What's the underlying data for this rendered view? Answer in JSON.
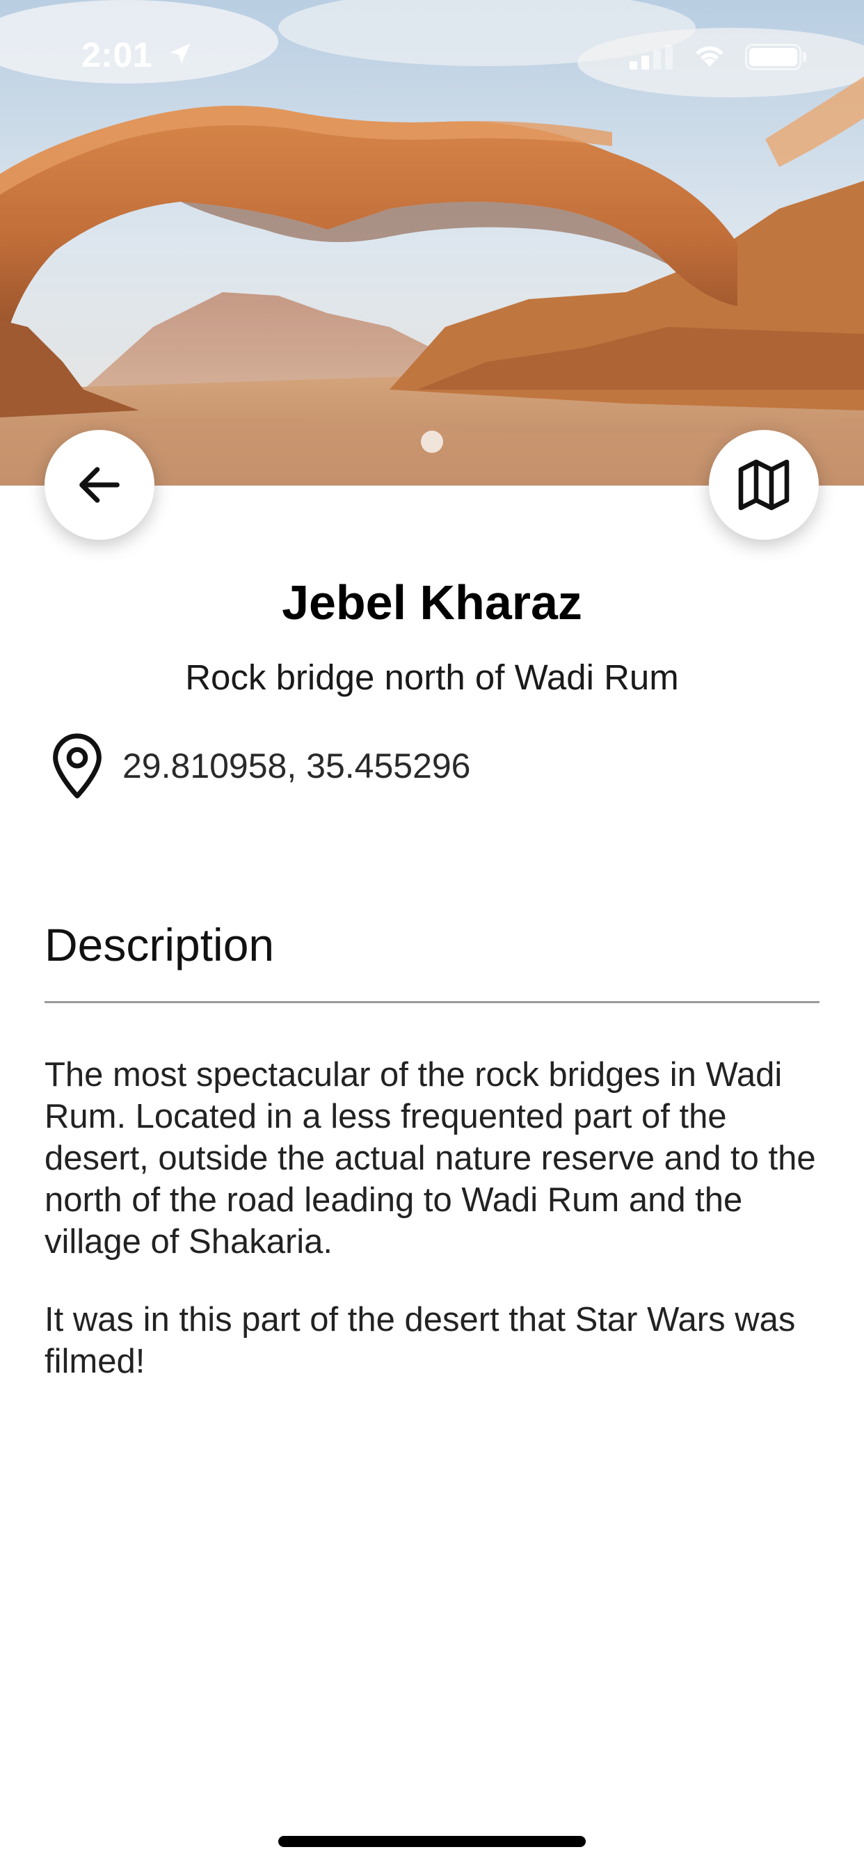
{
  "status_bar": {
    "time": "2:01"
  },
  "hero": {
    "image": "Rock arch in desert landscape",
    "pages": 1,
    "current_page": 1
  },
  "buttons": {
    "back_icon": "arrow-left-icon",
    "map_icon": "map-icon"
  },
  "place": {
    "name": "Jebel Kharaz",
    "subtitle": "Rock bridge north of Wadi Rum",
    "coordinates": "29.810958, 35.455296"
  },
  "description": {
    "heading": "Description",
    "paragraphs": [
      "The most spectacular of the rock bridges in Wadi Rum. Located in a less frequented part of the desert, outside the actual nature reserve and to the north of the road leading to Wadi Rum and the village of Shakaria.",
      "It was in this part of the desert that Star Wars was filmed!"
    ]
  },
  "colors": {
    "background": "#ffffff",
    "text": "#000000",
    "divider": "#9a9a9a",
    "sand": "#c98a55",
    "sky": "#c9d9e6"
  }
}
